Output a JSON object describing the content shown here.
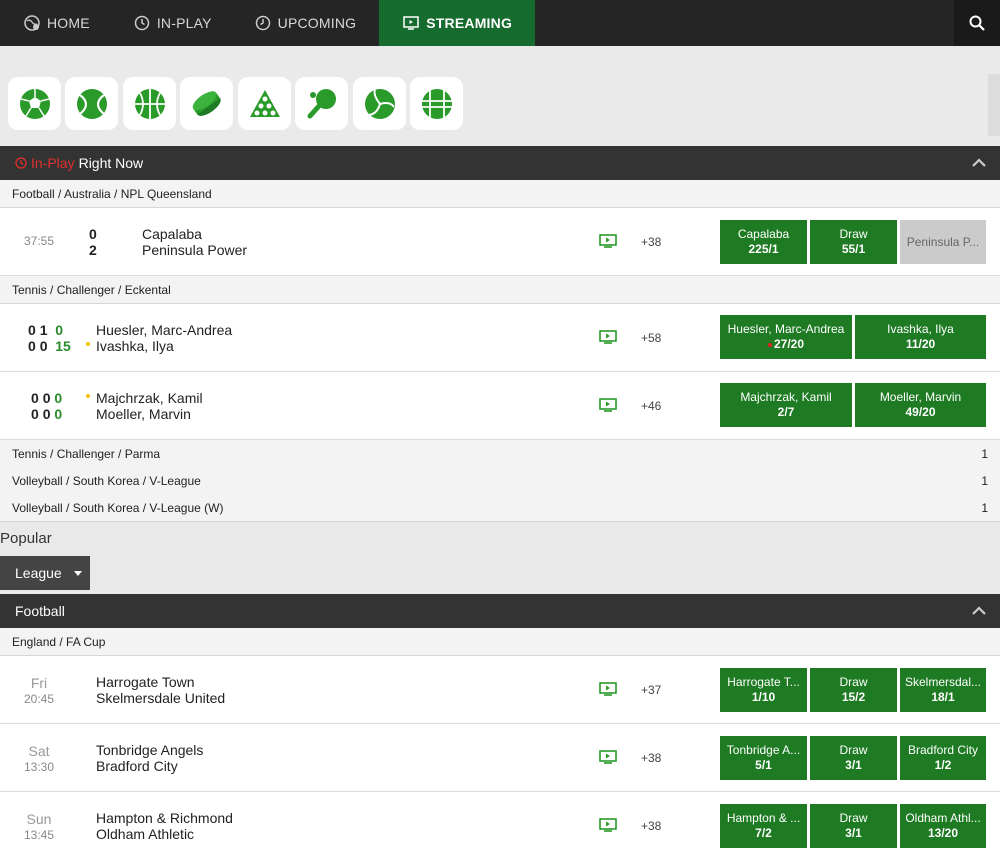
{
  "nav": {
    "tabs": [
      {
        "label": "HOME",
        "icon": "globe-icon"
      },
      {
        "label": "IN-PLAY",
        "icon": "clock-icon"
      },
      {
        "label": "UPCOMING",
        "icon": "clock-icon"
      },
      {
        "label": "STREAMING",
        "icon": "tv-icon",
        "active": true
      }
    ]
  },
  "sports": [
    "soccer-ball-icon",
    "tennis-ball-icon",
    "basketball-icon",
    "ice-hockey-puck-icon",
    "snooker-icon",
    "table-tennis-icon",
    "volleyball-icon",
    "handball-icon"
  ],
  "inplay": {
    "live_label": "In-Play",
    "title": "Right Now",
    "groups": [
      {
        "crumb": "Football / Australia / NPL Queensland",
        "events": [
          {
            "time": "37:55",
            "home_score": "0",
            "away_score": "2",
            "home": "Capalaba",
            "away": "Peninsula Power",
            "more": "+38",
            "odds": [
              {
                "name": "Capalaba",
                "price": "225/1"
              },
              {
                "name": "Draw",
                "price": "55/1"
              },
              {
                "name": "Peninsula P...",
                "price": ""
              }
            ]
          }
        ]
      },
      {
        "crumb": "Tennis / Challenger / Eckental",
        "events": [
          {
            "home_sets": "0",
            "home_games": "1",
            "home_points": "0",
            "away_sets": "0",
            "away_games": "0",
            "away_points": "15",
            "home": "Huesler, Marc-Andrea",
            "away": "Ivashka, Ilya",
            "more": "+58",
            "odds": [
              {
                "name": "Huesler, Marc-Andrea",
                "price": "27/20"
              },
              {
                "name": "Ivashka, Ilya",
                "price": "11/20"
              }
            ]
          },
          {
            "home_sets": "0",
            "home_games": "0",
            "home_points": "0",
            "away_sets": "0",
            "away_games": "0",
            "away_points": "0",
            "home": "Majchrzak, Kamil",
            "away": "Moeller, Marvin",
            "more": "+46",
            "odds": [
              {
                "name": "Majchrzak, Kamil",
                "price": "2/7"
              },
              {
                "name": "Moeller, Marvin",
                "price": "49/20"
              }
            ]
          }
        ]
      }
    ],
    "collapsed": [
      {
        "crumb": "Tennis / Challenger / Parma",
        "count": "1"
      },
      {
        "crumb": "Volleyball / South Korea / V-League",
        "count": "1"
      },
      {
        "crumb": "Volleyball / South Korea / V-League (W)",
        "count": "1"
      }
    ]
  },
  "popular": {
    "title": "Popular",
    "filter_label": "League",
    "section": "Football",
    "crumb": "England / FA Cup",
    "events": [
      {
        "day": "Fri",
        "time": "20:45",
        "home": "Harrogate Town",
        "away": "Skelmersdale United",
        "more": "+37",
        "odds": [
          {
            "name": "Harrogate T...",
            "price": "1/10"
          },
          {
            "name": "Draw",
            "price": "15/2"
          },
          {
            "name": "Skelmersdal...",
            "price": "18/1"
          }
        ]
      },
      {
        "day": "Sat",
        "time": "13:30",
        "home": "Tonbridge Angels",
        "away": "Bradford City",
        "more": "+38",
        "odds": [
          {
            "name": "Tonbridge A...",
            "price": "5/1"
          },
          {
            "name": "Draw",
            "price": "3/1"
          },
          {
            "name": "Bradford City",
            "price": "1/2"
          }
        ]
      },
      {
        "day": "Sun",
        "time": "13:45",
        "home": "Hampton & Richmond",
        "away": "Oldham Athletic",
        "more": "+38",
        "odds": [
          {
            "name": "Hampton & ...",
            "price": "7/2"
          },
          {
            "name": "Draw",
            "price": "3/1"
          },
          {
            "name": "Oldham Athl...",
            "price": "13/20"
          }
        ]
      }
    ]
  },
  "colors": {
    "brand_green": "#1e7a23",
    "nav_active": "#166b2e",
    "live_red": "#e0302f"
  }
}
